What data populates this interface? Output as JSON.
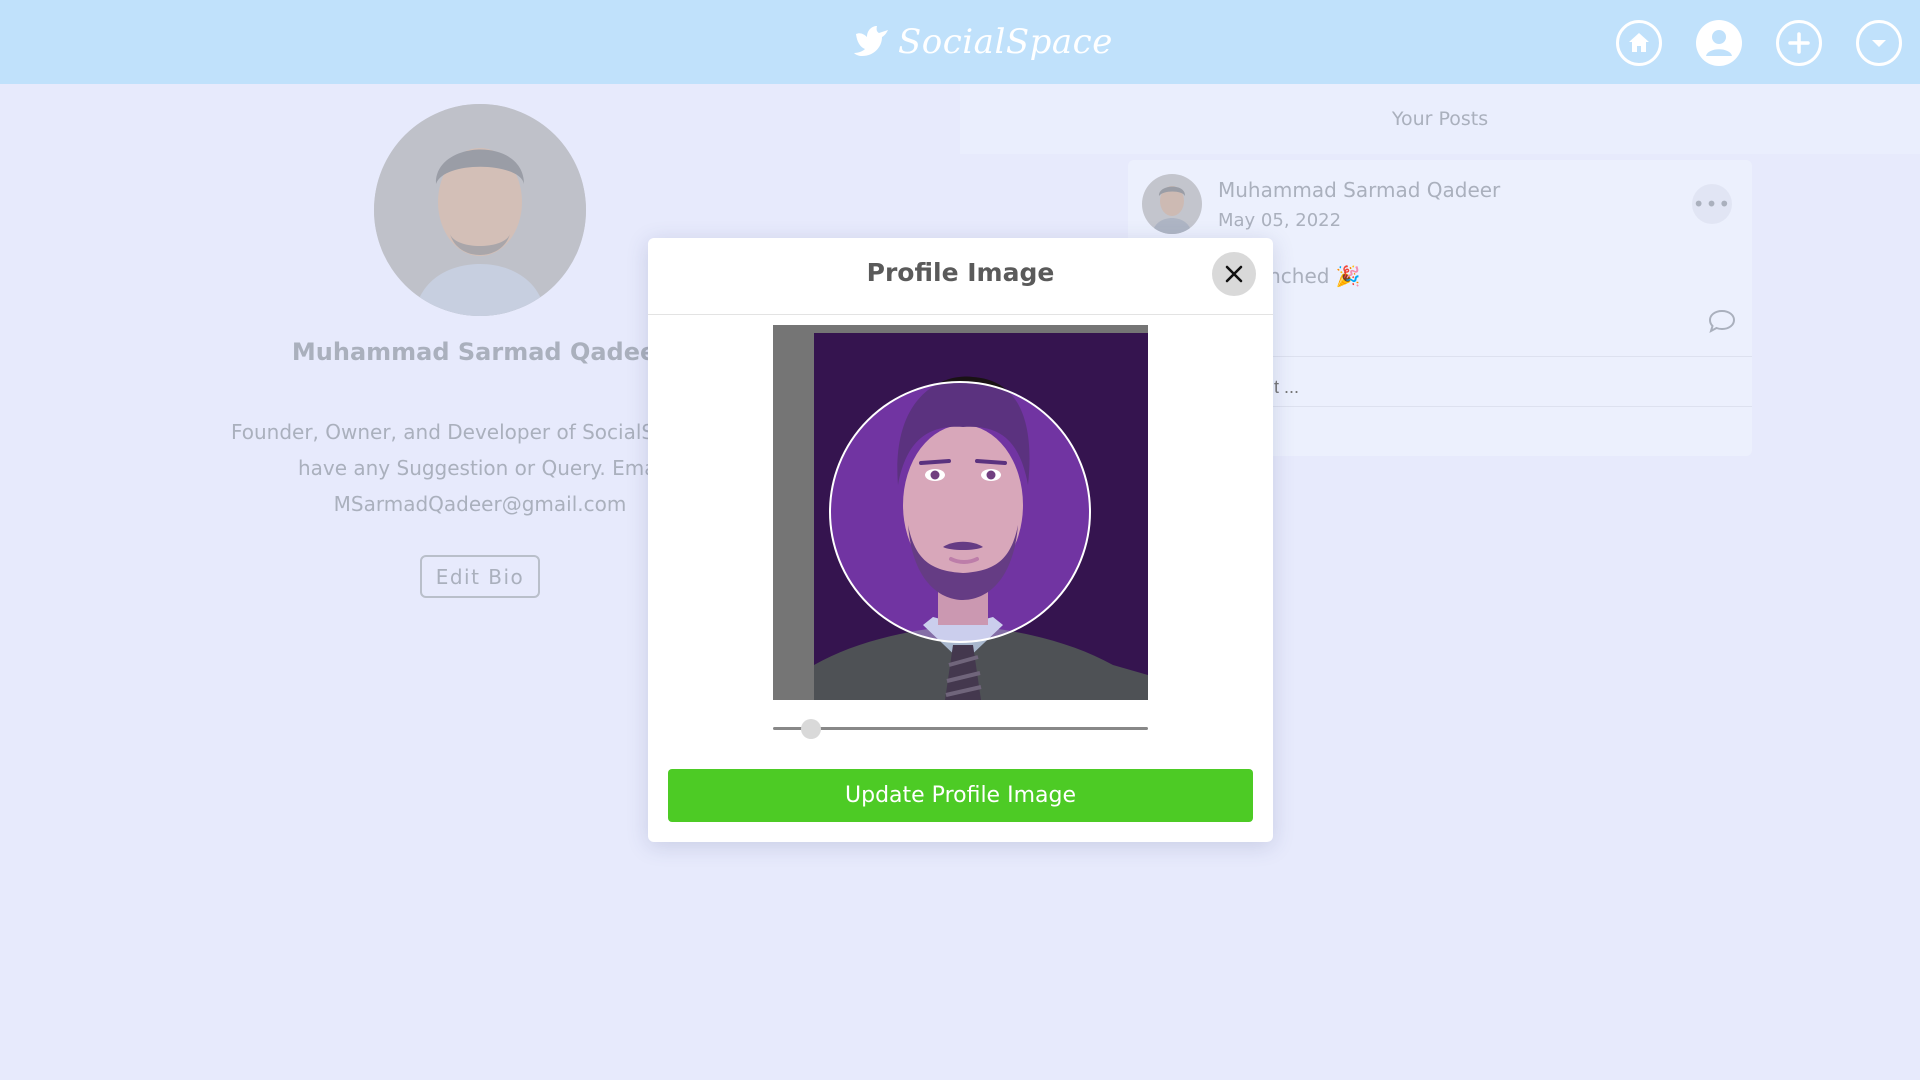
{
  "header": {
    "brand_name": "SocialSpace",
    "brand_icon": "bird-icon",
    "nav": [
      {
        "name": "home-icon"
      },
      {
        "name": "user-icon"
      },
      {
        "name": "plus-icon"
      },
      {
        "name": "chevron-down-icon"
      }
    ]
  },
  "profile": {
    "name": "Muhammad Sarmad Qadeer",
    "bio_lines": [
      "Founder, Owner, and Developer of SocialSpace. C",
      "have any Suggestion or Query. Emai",
      "MSarmadQadeer@gmail.com"
    ],
    "edit_bio_label": "Edit Bio"
  },
  "posts": {
    "heading": "Your Posts",
    "items": [
      {
        "author": "Muhammad Sarmad Qadeer",
        "date": "May 05, 2022",
        "text_visible": "Space is launched 🎉",
        "comment_placeholder_visible": "ent ..."
      }
    ]
  },
  "modal": {
    "title": "Profile Image",
    "zoom_fraction": 0.1,
    "update_label": "Update Profile Image"
  },
  "colors": {
    "header_bg": "#c0e1fb",
    "page_bg": "#e7eafc",
    "accent_green": "#4dcb25",
    "photo_purple": "#3a1656"
  }
}
